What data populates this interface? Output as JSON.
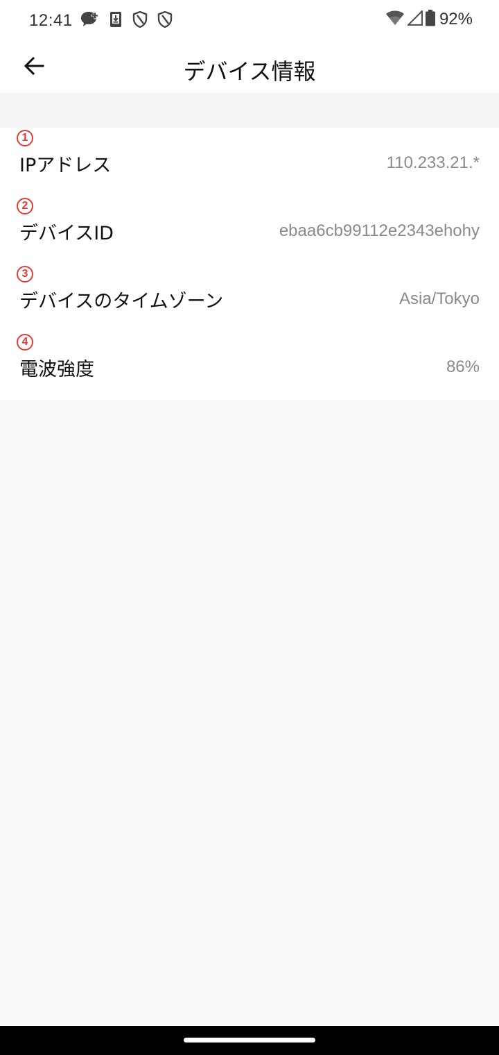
{
  "status_bar": {
    "time": "12:41",
    "battery": "92%",
    "icons": [
      "chat-plus-icon",
      "download-icon",
      "shield-icon",
      "shield-icon",
      "wifi-icon",
      "signal-icon",
      "battery-icon"
    ]
  },
  "header": {
    "title": "デバイス情報",
    "back_icon": "arrow-left-icon"
  },
  "rows": [
    {
      "marker": "1",
      "label": "IPアドレス",
      "value": "110.233.21.*"
    },
    {
      "marker": "2",
      "label": "デバイスID",
      "value": "ebaa6cb99112e2343ehohy"
    },
    {
      "marker": "3",
      "label": "デバイスのタイムゾーン",
      "value": "Asia/Tokyo"
    },
    {
      "marker": "4",
      "label": "電波強度",
      "value": "86%"
    }
  ],
  "colors": {
    "marker": "#e53935",
    "value_text": "#8a8a8a",
    "page_bg": "#f9f9f9"
  }
}
